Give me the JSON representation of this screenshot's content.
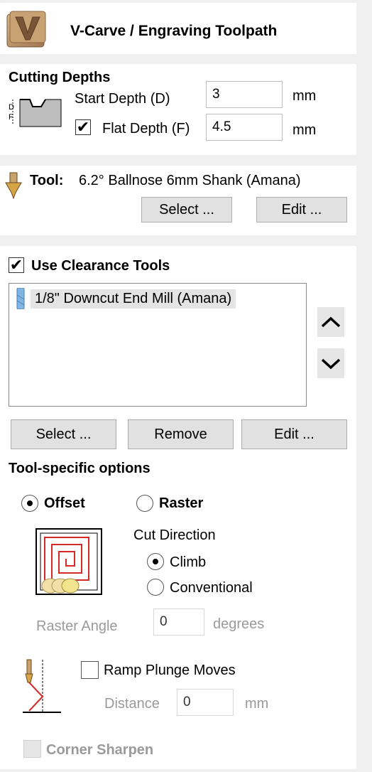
{
  "header": {
    "title": "V-Carve / Engraving Toolpath"
  },
  "cutting_depths": {
    "heading": "Cutting Depths",
    "start_label": "Start Depth (D)",
    "start_value": "3",
    "start_unit": "mm",
    "flat_label": "Flat Depth (F)",
    "flat_value": "4.5",
    "flat_unit": "mm",
    "flat_checked": true,
    "icon_letters": {
      "d": "D",
      "f": "F"
    }
  },
  "tool": {
    "label": "Tool:",
    "name": "6.2° Ballnose 6mm Shank (Amana)",
    "select_label": "Select ...",
    "edit_label": "Edit ..."
  },
  "clearance": {
    "checkbox_label": "Use Clearance Tools",
    "checked": true,
    "items": [
      "1/8\" Downcut End Mill (Amana)"
    ],
    "select_label": "Select ...",
    "remove_label": "Remove",
    "edit_label": "Edit ..."
  },
  "tool_options": {
    "heading": "Tool-specific options",
    "offset_label": "Offset",
    "raster_label": "Raster",
    "selected_strategy": "Offset",
    "cut_direction_label": "Cut Direction",
    "climb_label": "Climb",
    "conventional_label": "Conventional",
    "selected_direction": "Climb",
    "raster_angle_label": "Raster Angle",
    "raster_angle_value": "0",
    "raster_angle_unit": "degrees",
    "ramp_label": "Ramp Plunge Moves",
    "ramp_checked": false,
    "distance_label": "Distance",
    "distance_value": "0",
    "distance_unit": "mm",
    "corner_label": "Corner Sharpen",
    "corner_checked": false
  },
  "colors": {
    "panel": "#ffffff",
    "background": "#f0f0f0",
    "button": "#e1e1e1",
    "accent_red": "#d62a2a"
  }
}
